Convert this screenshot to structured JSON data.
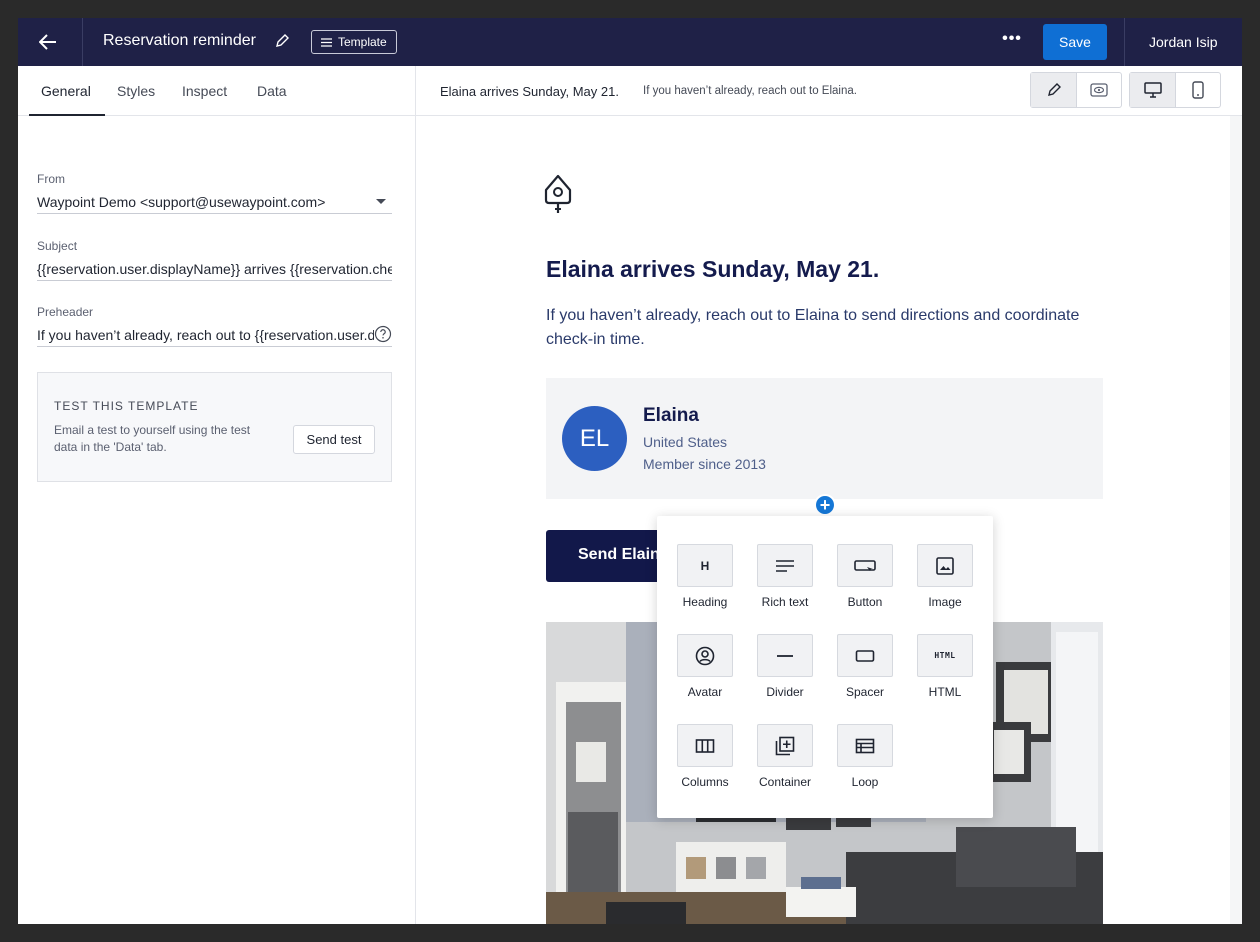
{
  "topbar": {
    "title": "Reservation reminder",
    "template_badge": "Template",
    "more_label": "•••",
    "save_label": "Save",
    "user_name": "Jordan Isip"
  },
  "left_panel": {
    "tabs": [
      {
        "label": "General",
        "active": true
      },
      {
        "label": "Styles",
        "active": false
      },
      {
        "label": "Inspect",
        "active": false
      },
      {
        "label": "Data",
        "active": false
      }
    ],
    "from": {
      "label": "From",
      "value": "Waypoint Demo <support@usewaypoint.com>"
    },
    "subject": {
      "label": "Subject",
      "value": "{{reservation.user.displayName}} arrives {{reservation.checkinDate}}"
    },
    "preheader": {
      "label": "Preheader",
      "value": "If you haven’t already, reach out to {{reservation.user.displayName}}"
    },
    "test": {
      "title": "TEST THIS TEMPLATE",
      "description": "Email a test to yourself using the test data in the 'Data' tab.",
      "button": "Send test"
    }
  },
  "preview_bar": {
    "subject": "Elaina arrives Sunday, May 21.",
    "preheader": "If you haven’t already, reach out to Elaina."
  },
  "email": {
    "heading": "Elaina arrives Sunday, May 21.",
    "body": "If you haven’t already, reach out to Elaina to send directions and coordinate check-in time.",
    "member": {
      "initials": "EL",
      "name": "Elaina",
      "country": "United States",
      "since": "Member since 2013"
    },
    "cta_label": "Send Elaina a message"
  },
  "add_button": "+",
  "block_menu": {
    "items": [
      {
        "label": "Heading",
        "icon": "heading-icon"
      },
      {
        "label": "Rich text",
        "icon": "rich-text-icon"
      },
      {
        "label": "Button",
        "icon": "button-icon"
      },
      {
        "label": "Image",
        "icon": "image-icon"
      },
      {
        "label": "Avatar",
        "icon": "avatar-icon"
      },
      {
        "label": "Divider",
        "icon": "divider-icon"
      },
      {
        "label": "Spacer",
        "icon": "spacer-icon"
      },
      {
        "label": "HTML",
        "icon": "html-icon"
      },
      {
        "label": "Columns",
        "icon": "columns-icon"
      },
      {
        "label": "Container",
        "icon": "container-icon"
      },
      {
        "label": "Loop",
        "icon": "loop-icon"
      }
    ],
    "heading_glyph": "H",
    "html_glyph": "HTML"
  },
  "colors": {
    "topbar": "#1f2147",
    "accent": "#0f6fd4",
    "navy": "#141b4d",
    "avatar": "#2c5fc0"
  }
}
